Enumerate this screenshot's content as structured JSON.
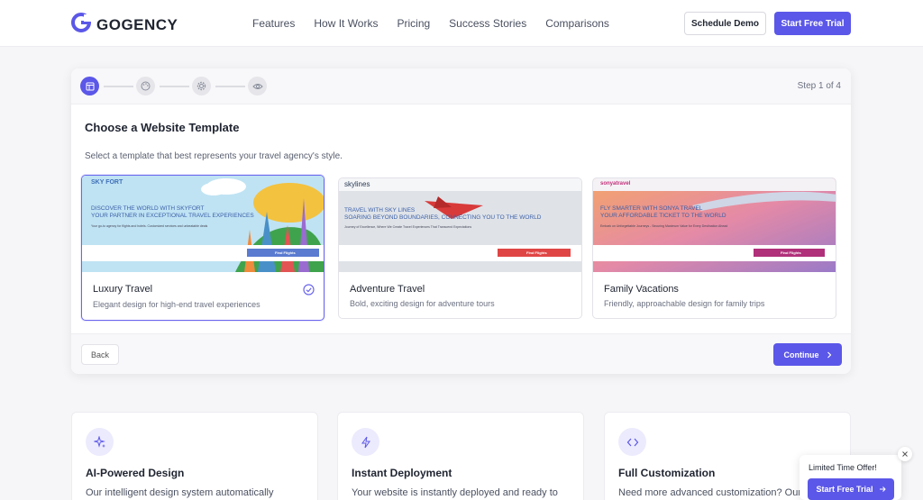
{
  "brand": {
    "name": "GOGENCY"
  },
  "nav": {
    "links": [
      "Features",
      "How It Works",
      "Pricing",
      "Success Stories",
      "Comparisons"
    ],
    "schedule_demo": "Schedule Demo",
    "start_trial": "Start Free Trial"
  },
  "wizard": {
    "step_label": "Step 1 of 4",
    "steps": [
      {
        "icon": "layout-icon",
        "active": true
      },
      {
        "icon": "palette-icon",
        "active": false
      },
      {
        "icon": "gear-icon",
        "active": false
      },
      {
        "icon": "eye-icon",
        "active": false
      }
    ],
    "title": "Choose a Website Template",
    "subtitle": "Select a template that best represents your travel agency's style.",
    "templates": [
      {
        "name": "Luxury Travel",
        "description": "Elegant design for high-end travel experiences",
        "selected": true,
        "preview": {
          "logo": "SKY FORT",
          "headline_1": "DISCOVER THE WORLD WITH SKYFORT",
          "headline_2": "YOUR PARTNER IN EXCEPTIONAL TRAVEL EXPERIENCES",
          "tagline": "Your go-to agency for flights and hotels. Customized services and unbeatable deals",
          "cta": "Find Flights"
        }
      },
      {
        "name": "Adventure Travel",
        "description": "Bold, exciting design for adventure tours",
        "selected": false,
        "preview": {
          "logo": "skylines",
          "headline_1": "TRAVEL WITH SKY LINES",
          "headline_2": "SOARING BEYOND BOUNDARIES, CONNECTING YOU TO THE WORLD",
          "tagline": "Journey of Excellence, Where We Create Travel Experiences That Transcend Expectations",
          "cta": "Find Flights"
        }
      },
      {
        "name": "Family Vacations",
        "description": "Friendly, approachable design for family trips",
        "selected": false,
        "preview": {
          "logo": "sonyatravel",
          "headline_1": "FLY SMARTER WITH SONYA TRAVEL",
          "headline_2": "YOUR AFFORDABLE TICKET TO THE WORLD",
          "tagline": "Embark on Unforgettable Journeys - Securing Maximum Value for Every Destination Ahead",
          "cta": "Find Flights"
        }
      }
    ],
    "back": "Back",
    "continue": "Continue"
  },
  "features": [
    {
      "icon": "sparkles-icon",
      "title": "AI-Powered Design",
      "description": "Our intelligent design system automatically"
    },
    {
      "icon": "lightning-icon",
      "title": "Instant Deployment",
      "description": "Your website is instantly deployed and ready to"
    },
    {
      "icon": "code-icon",
      "title": "Full Customization",
      "description": "Need more advanced customization? Our"
    }
  ],
  "promo": {
    "text": "Limited Time Offer!",
    "button": "Start Free Trial"
  },
  "colors": {
    "primary": "#5b57e8",
    "background": "#f6f6f8",
    "text": "#1f2430"
  }
}
